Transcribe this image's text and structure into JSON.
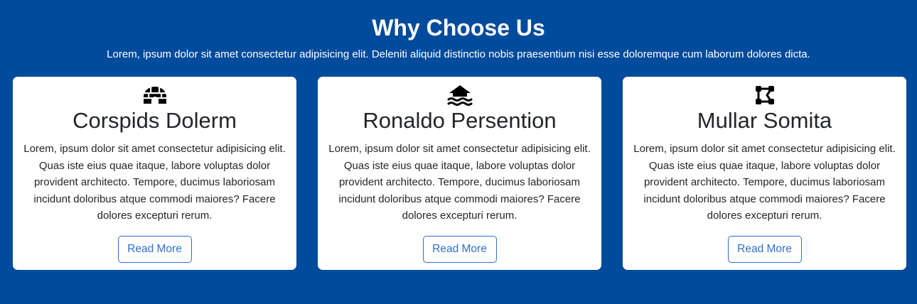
{
  "section": {
    "title": "Why Choose Us",
    "subtitle": "Lorem, ipsum dolor sit amet consectetur adipisicing elit. Deleniti aliquid distinctio nobis praesentium nisi esse doloremque cum laborum dolores dicta."
  },
  "cards": [
    {
      "icon": "igloo-icon",
      "title": "Corspids Dolerm",
      "text": "Lorem, ipsum dolor sit amet consectetur adipisicing elit. Quas iste eius quae itaque, labore voluptas dolor provident architecto. Tempore, ducimus laboriosam incidunt doloribus atque commodi maiores? Facere dolores excepturi rerum.",
      "button_label": "Read More"
    },
    {
      "icon": "house-flood-icon",
      "title": "Ronaldo Persention",
      "text": "Lorem, ipsum dolor sit amet consectetur adipisicing elit. Quas iste eius quae itaque, labore voluptas dolor provident architecto. Tempore, ducimus laboriosam incidunt doloribus atque commodi maiores? Facere dolores excepturi rerum.",
      "button_label": "Read More"
    },
    {
      "icon": "vector-shape-icon",
      "title": "Mullar Somita",
      "text": "Lorem, ipsum dolor sit amet consectetur adipisicing elit. Quas iste eius quae itaque, labore voluptas dolor provident architecto. Tempore, ducimus laboriosam incidunt doloribus atque commodi maiores? Facere dolores excepturi rerum.",
      "button_label": "Read More"
    }
  ],
  "colors": {
    "background": "#004b9c",
    "card": "#ffffff",
    "text": "#222529",
    "accent": "#2e6fd2"
  }
}
